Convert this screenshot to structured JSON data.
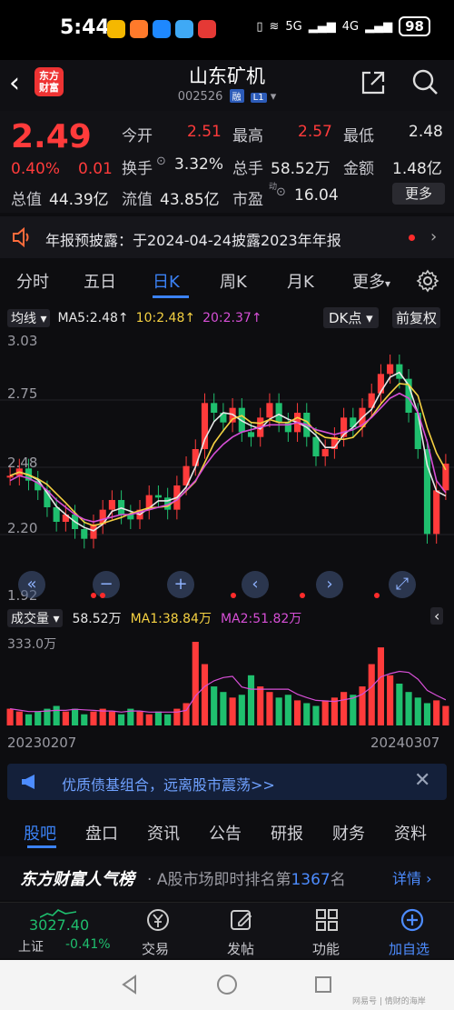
{
  "status_bar": {
    "time": "5:44",
    "battery": "98",
    "network_a": "5G",
    "network_b": "4G"
  },
  "header": {
    "logo_line1": "东方",
    "logo_line2": "财富",
    "title": "山东矿机",
    "code": "002526",
    "tag_rong": "融",
    "tag_level": "L1"
  },
  "quote": {
    "price": "2.49",
    "change_pct": "0.40%",
    "change_abs": "0.01",
    "open_label": "今开",
    "open": "2.51",
    "high_label": "最高",
    "high": "2.57",
    "low_label": "最低",
    "low": "2.48",
    "turnover_label": "换手",
    "turnover": "3.32%",
    "volume_label": "总手",
    "volume": "58.52万",
    "amount_label": "金额",
    "amount": "1.48亿",
    "mcap_label": "总值",
    "mcap": "44.39亿",
    "float_label": "流值",
    "float": "43.85亿",
    "pe_label": "市盈",
    "pe_sup": "动",
    "pe": "16.04",
    "more": "更多"
  },
  "notice": {
    "text": "年报预披露：于2024-04-24披露2023年年报"
  },
  "tabs": [
    "分时",
    "五日",
    "日K",
    "周K",
    "月K",
    "更多"
  ],
  "chart_bar": {
    "ma_chip": "均线",
    "ma5": "MA5:2.48↑",
    "ma10": "10:2.48↑",
    "ma20": "20:2.37↑",
    "dk": "DK点",
    "adjust": "前复权"
  },
  "volume_bar": {
    "chip": "成交量",
    "vol": "58.52万",
    "ma1": "MA1:38.84万",
    "ma2": "MA2:51.82万",
    "max": "333.0万"
  },
  "colors": {
    "up": "#ff3b3b",
    "down": "#1fbf6e",
    "ma5": "#e8e8e8",
    "ma10": "#f5d142",
    "ma20": "#d64fd6",
    "accent": "#3b82f6"
  },
  "chart_data": {
    "type": "line",
    "title": "",
    "yticks": [
      "3.03",
      "2.75",
      "2.48",
      "2.20",
      "1.92"
    ],
    "ylim": [
      1.92,
      3.03
    ],
    "xlabels": [
      "20230207",
      "20240307"
    ],
    "close": [
      2.44,
      2.47,
      2.42,
      2.38,
      2.31,
      2.25,
      2.28,
      2.22,
      2.18,
      2.24,
      2.3,
      2.34,
      2.28,
      2.26,
      2.3,
      2.36,
      2.35,
      2.3,
      2.4,
      2.48,
      2.55,
      2.74,
      2.7,
      2.66,
      2.72,
      2.62,
      2.6,
      2.68,
      2.74,
      2.66,
      2.62,
      2.7,
      2.6,
      2.52,
      2.55,
      2.6,
      2.68,
      2.64,
      2.72,
      2.78,
      2.86,
      2.9,
      2.84,
      2.7,
      2.55,
      2.2,
      2.38,
      2.49
    ],
    "ma20": [
      2.42,
      2.44,
      2.43,
      2.41,
      2.38,
      2.34,
      2.31,
      2.28,
      2.26,
      2.25,
      2.26,
      2.27,
      2.28,
      2.28,
      2.29,
      2.3,
      2.31,
      2.32,
      2.34,
      2.38,
      2.42,
      2.48,
      2.53,
      2.57,
      2.6,
      2.62,
      2.63,
      2.64,
      2.65,
      2.65,
      2.65,
      2.66,
      2.65,
      2.63,
      2.62,
      2.61,
      2.62,
      2.63,
      2.65,
      2.68,
      2.72,
      2.76,
      2.78,
      2.76,
      2.7,
      2.58,
      2.42,
      2.37
    ],
    "volume": [
      6,
      5,
      4,
      5,
      6,
      7,
      5,
      6,
      4,
      5,
      6,
      5,
      4,
      6,
      5,
      4,
      5,
      4,
      6,
      8,
      30,
      22,
      14,
      12,
      10,
      11,
      18,
      14,
      12,
      10,
      11,
      9,
      8,
      7,
      9,
      10,
      12,
      11,
      14,
      22,
      28,
      18,
      15,
      12,
      10,
      8,
      9,
      7
    ]
  },
  "controls": [
    "«",
    "−",
    "+",
    "‹",
    "›",
    "⤢"
  ],
  "banner": {
    "text": "优质债基组合，远离股市震荡>>"
  },
  "bottom_tabs": [
    "股吧",
    "盘口",
    "资讯",
    "公告",
    "研报",
    "财务",
    "资料"
  ],
  "rank": {
    "brand": "东方财富人气榜",
    "text": "A股市场即时排名第",
    "rank_no": "1367",
    "rank_suffix": "名",
    "detail": "详情"
  },
  "bottom_nav": {
    "index_value": "3027.40",
    "index_name": "上证",
    "index_change": "-0.41%",
    "trade": "交易",
    "post": "发帖",
    "func": "功能",
    "add": "加自选"
  },
  "watermark": "网易号 | 情财的海岸"
}
